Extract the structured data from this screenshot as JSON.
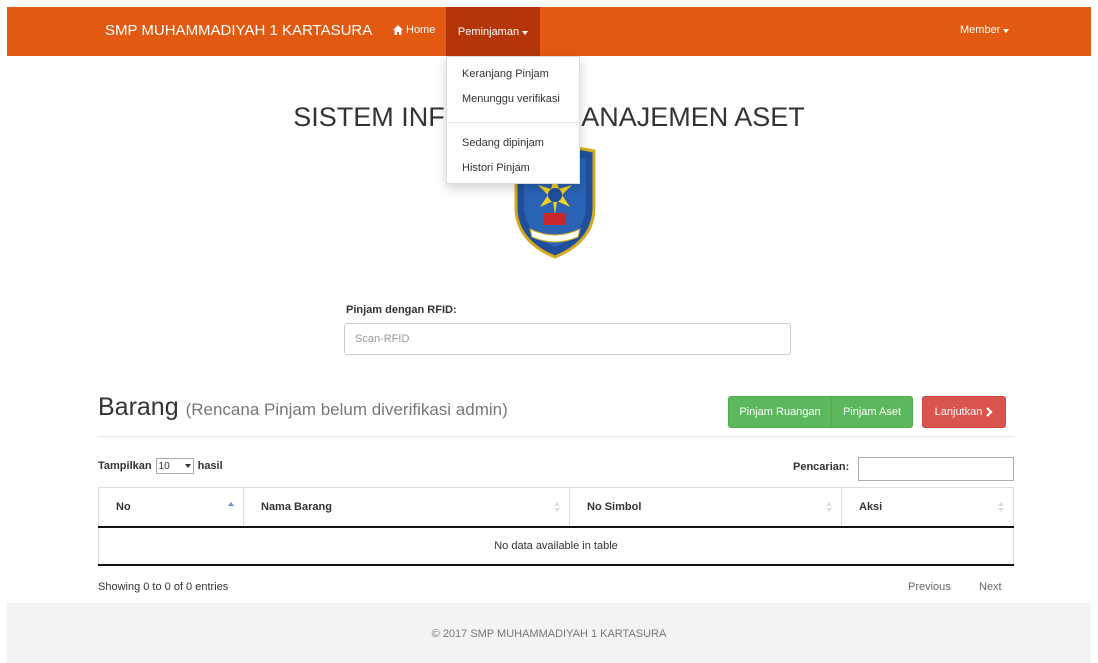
{
  "navbar": {
    "brand": "SMP MUHAMMADIYAH 1 KARTASURA",
    "home_label": "Home",
    "peminjaman_label": "Peminjaman",
    "member_label": "Member",
    "color": "#e25a12",
    "active_color": "#b5350a"
  },
  "dropdown": {
    "items": [
      "Keranjang Pinjam",
      "Menunggu verifikasi",
      "Sedang dipinjam",
      "Histori Pinjam"
    ]
  },
  "main": {
    "title": "SISTEM INFORMASI MANAJEMEN ASET",
    "logo_icon": "school-crest-icon"
  },
  "rfid": {
    "label": "Pinjam dengan RFID:",
    "placeholder": "Scan-RFID"
  },
  "section": {
    "title": "Barang",
    "subtitle": "(Rencana Pinjam belum diverifikasi admin)",
    "buttons": {
      "pinjam_ruangan": "Pinjam Ruangan",
      "pinjam_aset": "Pinjam Aset",
      "lanjutkan": "Lanjutkan"
    }
  },
  "table": {
    "length_prefix": "Tampilkan",
    "length_value": "10",
    "length_suffix": "hasil",
    "search_label": "Pencarian:",
    "columns": [
      "No",
      "Nama Barang",
      "No Simbol",
      "Aksi"
    ],
    "empty_message": "No data available in table",
    "info": "Showing 0 to 0 of 0 entries",
    "previous": "Previous",
    "next": "Next"
  },
  "footer": {
    "text": "© 2017 SMP MUHAMMADIYAH 1 KARTASURA"
  }
}
